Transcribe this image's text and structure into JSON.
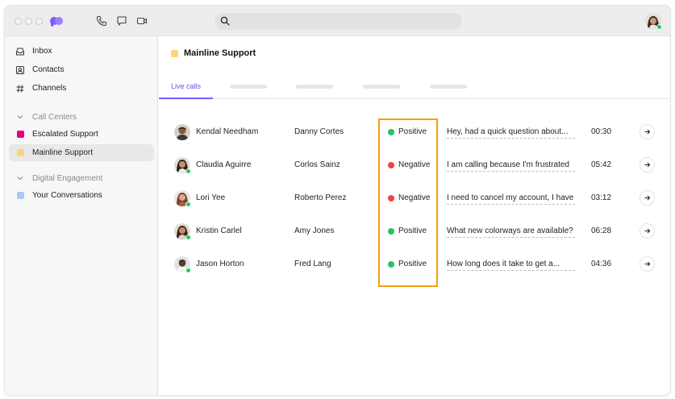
{
  "colors": {
    "accent": "#7c5cff",
    "positive": "#22c55e",
    "negative": "#ef4444",
    "highlight": "#f59e0b",
    "escalated": "#e6007e",
    "mainline": "#fdd27a",
    "your_conversations": "#a9c8f5"
  },
  "titlebar": {
    "icons": [
      "logo-icon",
      "phone-icon",
      "chat-icon",
      "video-icon",
      "search-icon"
    ],
    "search_placeholder": ""
  },
  "sidebar": {
    "items": [
      {
        "label": "Inbox",
        "icon": "inbox-icon"
      },
      {
        "label": "Contacts",
        "icon": "contacts-icon"
      },
      {
        "label": "Channels",
        "icon": "hash-icon"
      }
    ],
    "sections": [
      {
        "label": "Call Centers",
        "items": [
          {
            "label": "Escalated Support",
            "color": "#e6007e"
          },
          {
            "label": "Mainline Support",
            "color": "#fdd27a"
          }
        ]
      },
      {
        "label": "Digital Engagement",
        "items": [
          {
            "label": "Your Conversations",
            "color": "#a9c8f5"
          }
        ]
      }
    ]
  },
  "main": {
    "title": "Mainline Support",
    "tabs": {
      "active": "Live calls"
    },
    "rows": [
      {
        "name": "Kendal Needham",
        "agent": "Danny Cortes",
        "sentiment": "Positive",
        "message": "Hey, had a quick question about...",
        "duration": "00:30"
      },
      {
        "name": "Claudia Aguirre",
        "agent": "Corlos Sainz",
        "sentiment": "Negative",
        "message": "I am calling because I'm frustrated",
        "duration": "05:42"
      },
      {
        "name": "Lori Yee",
        "agent": "Roberto Perez",
        "sentiment": "Negative",
        "message": "I need to cancel my account, I have",
        "duration": "03:12"
      },
      {
        "name": "Kristin Carlel",
        "agent": "Amy Jones",
        "sentiment": "Positive",
        "message": "What new colorways are available?",
        "duration": "06:28"
      },
      {
        "name": "Jason Horton",
        "agent": "Fred Lang",
        "sentiment": "Positive",
        "message": "How long does it take to get a...",
        "duration": "04:36"
      }
    ]
  }
}
